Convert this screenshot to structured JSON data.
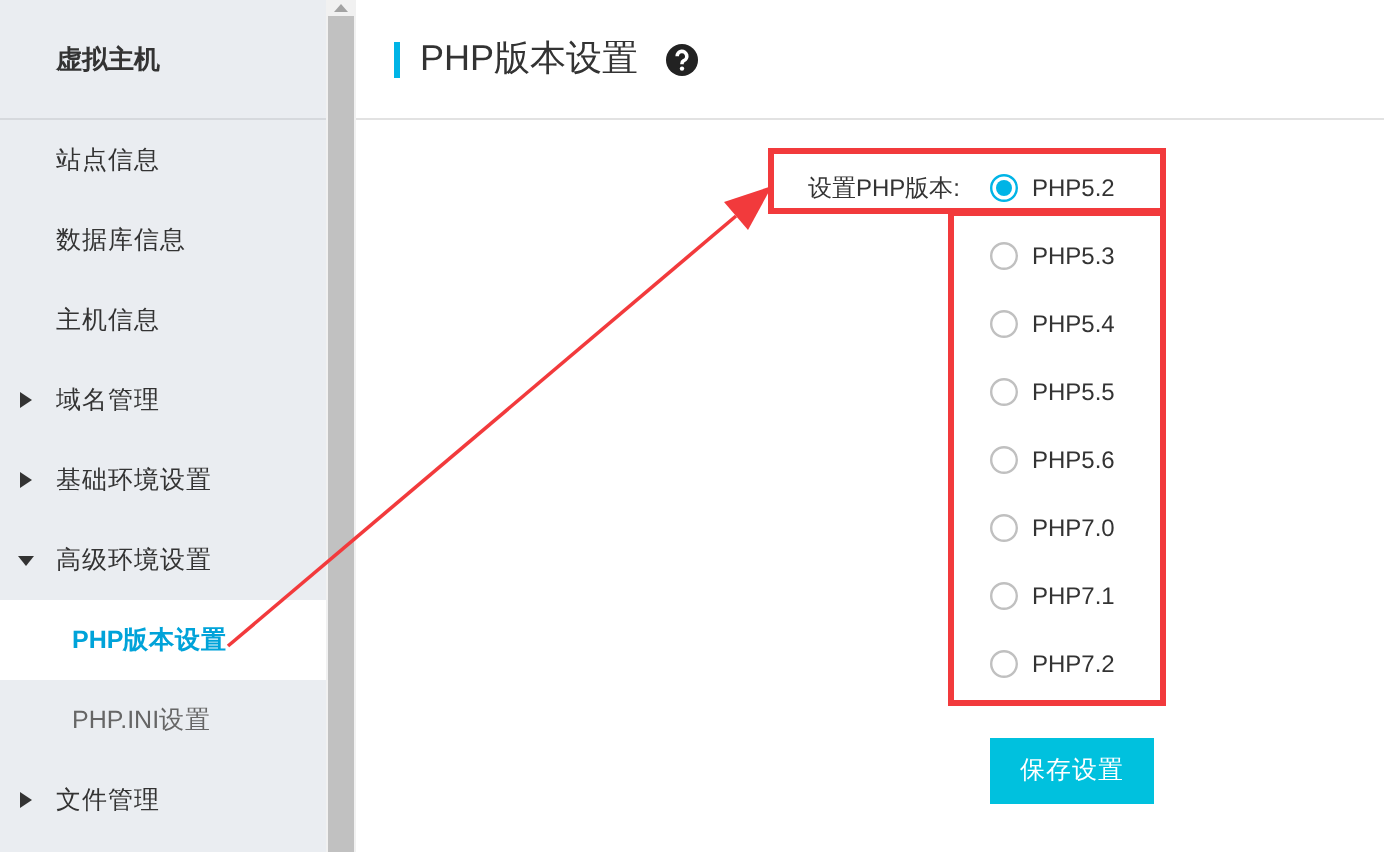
{
  "sidebar": {
    "title": "虚拟主机",
    "items": [
      {
        "kind": "link",
        "label": "站点信息",
        "selected": false
      },
      {
        "kind": "link",
        "label": "数据库信息",
        "selected": false
      },
      {
        "kind": "link",
        "label": "主机信息",
        "selected": false
      },
      {
        "kind": "group",
        "label": "域名管理",
        "expanded": false,
        "selected": false
      },
      {
        "kind": "group",
        "label": "基础环境设置",
        "expanded": false,
        "selected": false
      },
      {
        "kind": "group",
        "label": "高级环境设置",
        "expanded": true,
        "selected": false,
        "children": [
          {
            "label": "PHP版本设置",
            "selected": true
          },
          {
            "label": "PHP.INI设置",
            "selected": false
          }
        ]
      },
      {
        "kind": "group",
        "label": "文件管理",
        "expanded": false,
        "selected": false
      }
    ]
  },
  "page": {
    "title": "PHP版本设置",
    "form": {
      "label": "设置PHP版本:",
      "options": [
        {
          "label": "PHP5.2",
          "selected": true
        },
        {
          "label": "PHP5.3",
          "selected": false
        },
        {
          "label": "PHP5.4",
          "selected": false
        },
        {
          "label": "PHP5.5",
          "selected": false
        },
        {
          "label": "PHP5.6",
          "selected": false
        },
        {
          "label": "PHP7.0",
          "selected": false
        },
        {
          "label": "PHP7.1",
          "selected": false
        },
        {
          "label": "PHP7.2",
          "selected": false
        }
      ]
    },
    "save_button": "保存设置"
  }
}
